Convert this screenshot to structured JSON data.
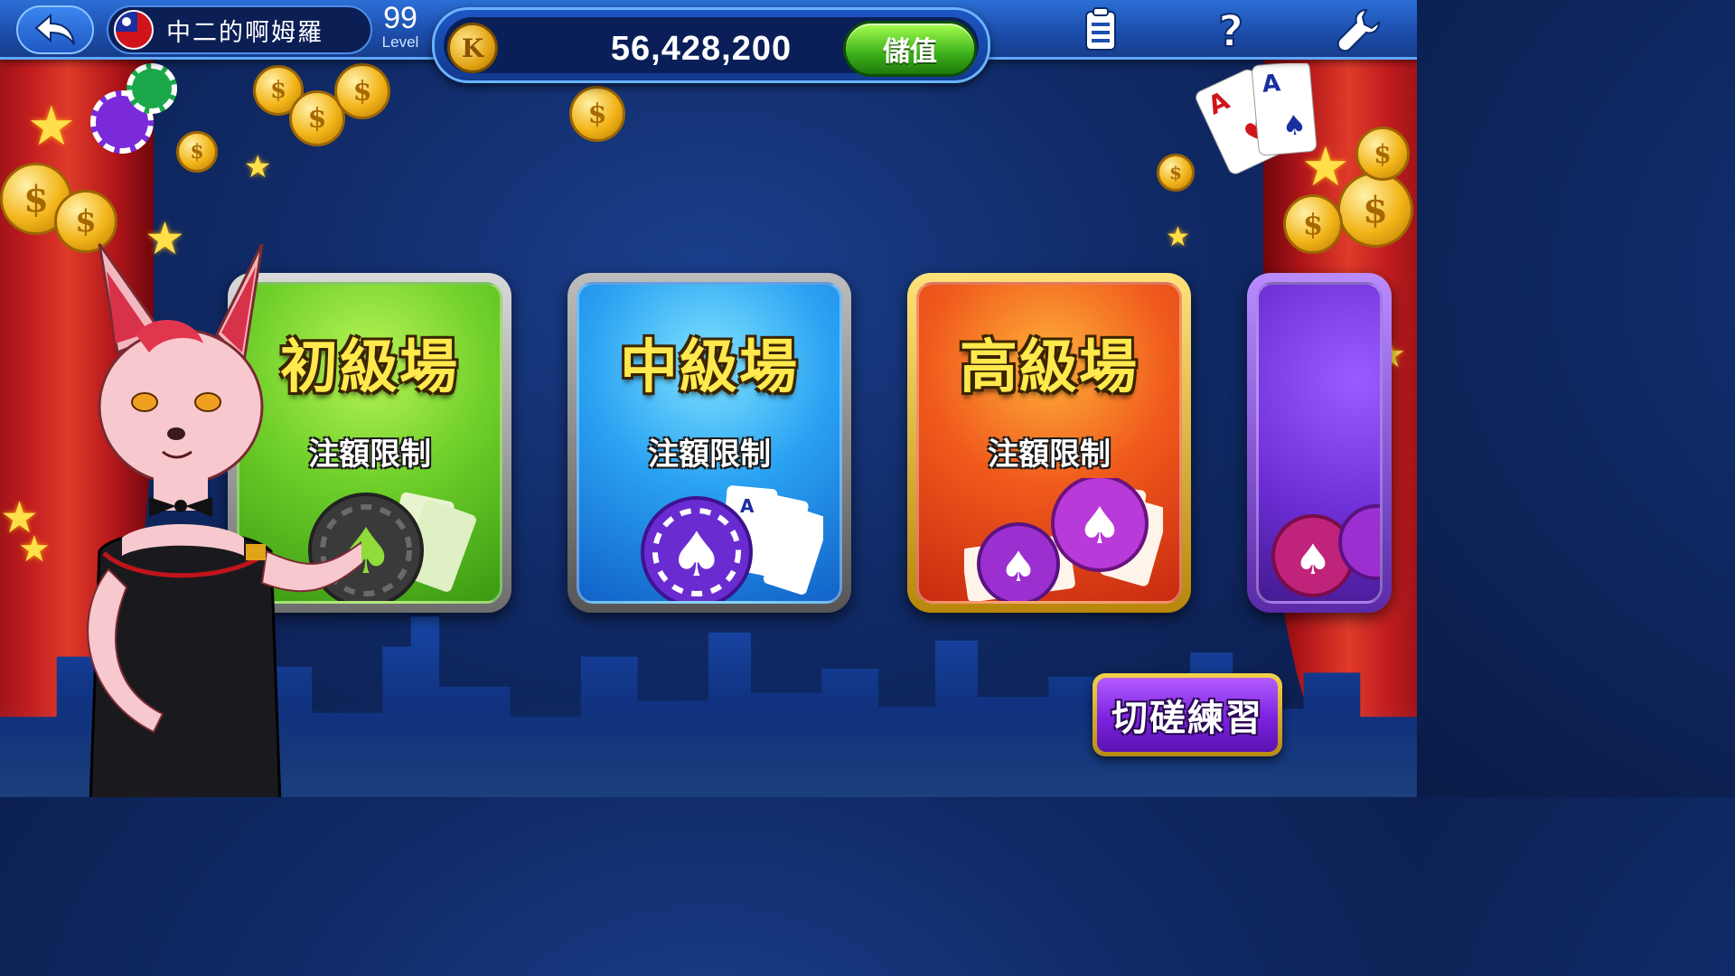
{
  "header": {
    "player_name": "中二的啊姆羅",
    "level_number": "99",
    "level_label": "Level",
    "coin_balance": "56,428,200",
    "topup_label": "儲值",
    "coin_symbol": "K"
  },
  "icons": {
    "back": "back-arrow-icon",
    "flag": "taiwan-flag-icon",
    "coin": "coin-icon",
    "records": "clipboard-icon",
    "help": "question-mark-icon",
    "settings": "wrench-icon"
  },
  "rooms": [
    {
      "title": "初級場",
      "subtitle": "注額限制",
      "theme": "#6fcf2a"
    },
    {
      "title": "中級場",
      "subtitle": "注額限制",
      "theme": "#2aa2f2"
    },
    {
      "title": "高級場",
      "subtitle": "注額限制",
      "theme": "#f05a1c"
    },
    {
      "title": "",
      "subtitle": "",
      "theme": "#6a2cd1"
    }
  ],
  "practice_button_label": "切磋練習",
  "colors": {
    "topbar": "#1d4fae",
    "background": "#102a66",
    "topup_green": "#3bb01a",
    "practice_purple": "#7c22e0",
    "title_gold": "#ffe94d"
  }
}
